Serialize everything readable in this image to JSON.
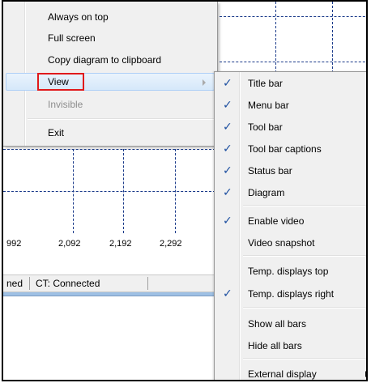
{
  "main_menu": {
    "items": [
      {
        "label": "Always on top",
        "disabled": false
      },
      {
        "label": "Full screen",
        "disabled": false
      },
      {
        "label": "Copy diagram to clipboard",
        "disabled": false
      },
      {
        "label": "View",
        "disabled": false,
        "highlighted": true,
        "has_submenu": true
      },
      {
        "label": "Invisible",
        "disabled": true
      },
      {
        "label": "Exit",
        "disabled": false
      }
    ]
  },
  "view_submenu": {
    "items": [
      {
        "label": "Title bar",
        "checked": true
      },
      {
        "label": "Menu bar",
        "checked": true
      },
      {
        "label": "Tool bar",
        "checked": true
      },
      {
        "label": "Tool bar captions",
        "checked": true
      },
      {
        "label": "Status bar",
        "checked": true
      },
      {
        "label": "Diagram",
        "checked": true
      },
      {
        "label": "Enable video",
        "checked": true
      },
      {
        "label": "Video snapshot",
        "checked": false
      },
      {
        "label": "Temp. displays top",
        "checked": false
      },
      {
        "label": "Temp. displays right",
        "checked": true
      },
      {
        "label": "Show all bars",
        "checked": false
      },
      {
        "label": "Hide all bars",
        "checked": false
      },
      {
        "label": "External display",
        "checked": false,
        "has_submenu": true
      }
    ],
    "check_glyph": "✓"
  },
  "chart": {
    "x_tick_labels": [
      "992",
      "2,092",
      "2,192",
      "2,292"
    ]
  },
  "status_bar": {
    "left_text": "ned",
    "right_text": "CT: Connected"
  },
  "colors": {
    "highlight_box": "#e0191b",
    "check": "#1d4fa0",
    "grid": "#1a3a8a"
  }
}
